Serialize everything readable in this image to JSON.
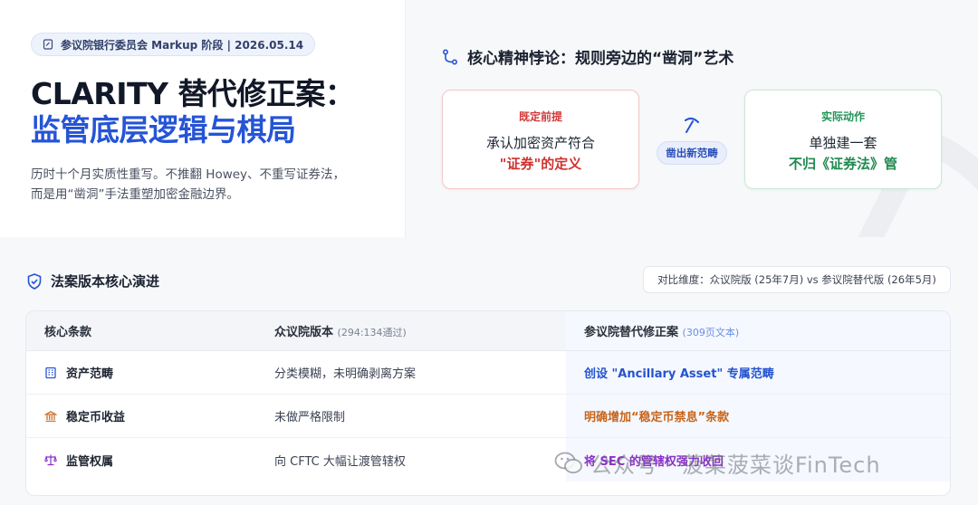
{
  "hero": {
    "badge": "参议院银行委员会 Markup 阶段 | 2026.05.14",
    "title_line1": "CLARITY 替代修正案：",
    "title_line2": "监管底层逻辑与棋局",
    "intro": "历时十个月实质性重写。不推翻 Howey、不重写证券法，而是用“凿洞”手法重塑加密金融边界。"
  },
  "paradox": {
    "title": "核心精神悖论：规则旁边的“凿洞”艺术",
    "premise": {
      "caption": "既定前提",
      "line1": "承认加密资产符合",
      "line2": "\"证券\"的定义"
    },
    "middle_label": "凿出新范畴",
    "action": {
      "caption": "实际动作",
      "line1": "单独建一套",
      "line2": "不归《证券法》管"
    }
  },
  "section": {
    "title": "法案版本核心演进",
    "compare_label": "对比维度：众议院版 (25年7月) vs 参议院替代版 (26年5月)"
  },
  "table": {
    "headers": {
      "col1": "核心条款",
      "col2": "众议院版本",
      "col2_sub": "(294:134通过)",
      "col3": "参议院替代修正案",
      "col3_sub": "(309页文本)"
    },
    "rows": [
      {
        "icon": "building-icon",
        "clause": "资产范畴",
        "house": "分类模糊，未明确剥离方案",
        "senate": "创设 \"Ancillary Asset\" 专属范畴"
      },
      {
        "icon": "bank-icon",
        "clause": "稳定币收益",
        "house": "未做严格限制",
        "senate": "明确增加“稳定币禁息”条款"
      },
      {
        "icon": "scale-icon",
        "clause": "监管权属",
        "house": "向 CFTC 大幅让渡管辖权",
        "senate": "将 SEC 的管辖权强力收回"
      }
    ]
  },
  "watermark": "公众号 · 菠菜菠菜谈FinTech",
  "colors": {
    "accent": "#2554d6",
    "red": "#d0312d",
    "green": "#1f8a4f",
    "orange": "#c8651a",
    "purple": "#8a2fc8"
  }
}
